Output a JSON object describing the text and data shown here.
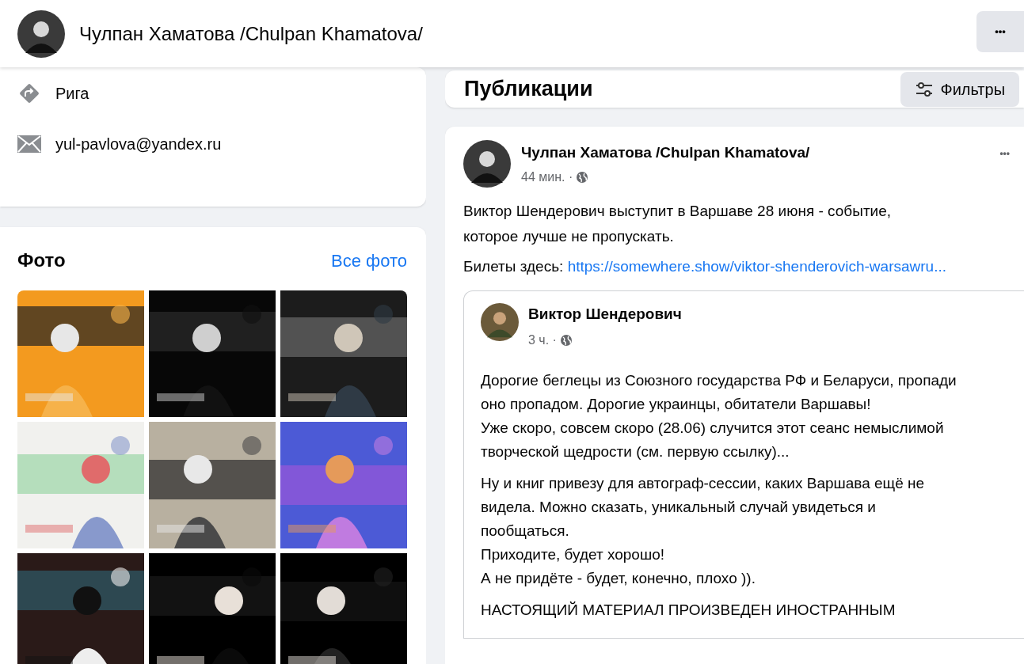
{
  "header": {
    "title": "Чулпан Хаматова /Chulpan Khamatova/",
    "more_button": "•••"
  },
  "intro": {
    "items": [
      {
        "kind": "location",
        "text": "Рига"
      },
      {
        "kind": "email",
        "text": "yul-pavlova@yandex.ru"
      }
    ]
  },
  "photos": {
    "title": "Фото",
    "link": "Все фото"
  },
  "publications": {
    "title": "Публикации",
    "filter_button": "Фильтры"
  },
  "post": {
    "author": "Чулпан Хаматова /Chulpan Khamatova/",
    "time": "44 мин. ·",
    "more": "•••",
    "text": "Виктор Шендерович выступит в Варшаве 28 июня - событие, которое лучше не пропускать.",
    "link_label": "Билеты здесь:",
    "link": "https://somewhere.show/viktor-shenderovich-warsawru...",
    "shared": {
      "author": "Виктор Шендерович",
      "time": "3 ч. ·",
      "paragraphs": [
        [
          "Дорогие беглецы из Союзного государства РФ и Беларуси, пропади оно пропадом. Дорогие украинцы, обитатели Варшавы!",
          "Уже скоро, совсем скоро (28.06) случится этот сеанс немыслимой творческой щедрости (см. первую ссылку)..."
        ],
        [
          "Ну и книг привезу для автограф-сессии, каких Варшава ещё не видела. Можно сказать, уникальный случай увидеться и пообщаться.",
          "Приходите, будет хорошо!",
          "А не придёте - будет, конечно, плохо ))."
        ],
        [
          "НАСТОЯЩИЙ МАТЕРИАЛ ПРОИЗВЕДЕН ИНОСТРАННЫМ"
        ]
      ]
    }
  }
}
